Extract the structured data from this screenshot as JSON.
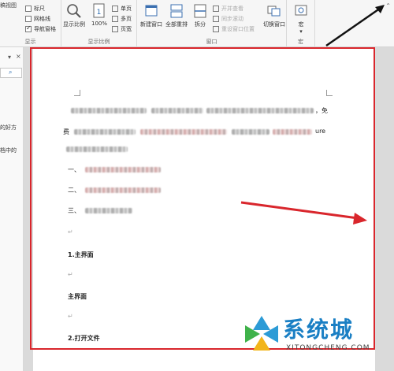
{
  "ribbon": {
    "left_edge_btn": "稿视图",
    "show": {
      "checkboxes": [
        {
          "label": "标尺",
          "checked": false
        },
        {
          "label": "网格线",
          "checked": false
        },
        {
          "label": "导航窗格",
          "checked": true
        }
      ],
      "group_label": "显示"
    },
    "zoom": {
      "zoom_btn": "显示比例",
      "pct_btn": "100%",
      "single_page": "单页",
      "multi_page": "多页",
      "page_width": "页宽",
      "group_label": "显示比例"
    },
    "window": {
      "new_window": "新建窗口",
      "arrange_all": "全部重排",
      "split": "拆分",
      "side_by_side": "开并查看",
      "sync_scroll": "同步滚动",
      "reset_position": "重设窗口位置",
      "switch_window": "切换窗口",
      "group_label": "窗口"
    },
    "macros": {
      "macro_btn": "宏",
      "group_label": "宏"
    }
  },
  "navpane": {
    "close_glyph": "×",
    "dropdown_glyph": "▾",
    "search_glyph": "⌕",
    "text_1": "的好方",
    "text_2": "档中的"
  },
  "document": {
    "list_1": "一、",
    "list_2": "二、",
    "list_3": "三、",
    "heading_1": "1.主界面",
    "heading_2": "主界面",
    "heading_3": "2.打开文件",
    "para_end_glyph": "↵",
    "fragment_mian": "，免",
    "fragment_fei": "费",
    "fragment_ure": "ure"
  },
  "watermark": {
    "text": "系统城",
    "url": "XITONGCHENG.COM"
  },
  "colors": {
    "annotation_red": "#d9262c",
    "watermark_blue": "#1a7fc4"
  }
}
